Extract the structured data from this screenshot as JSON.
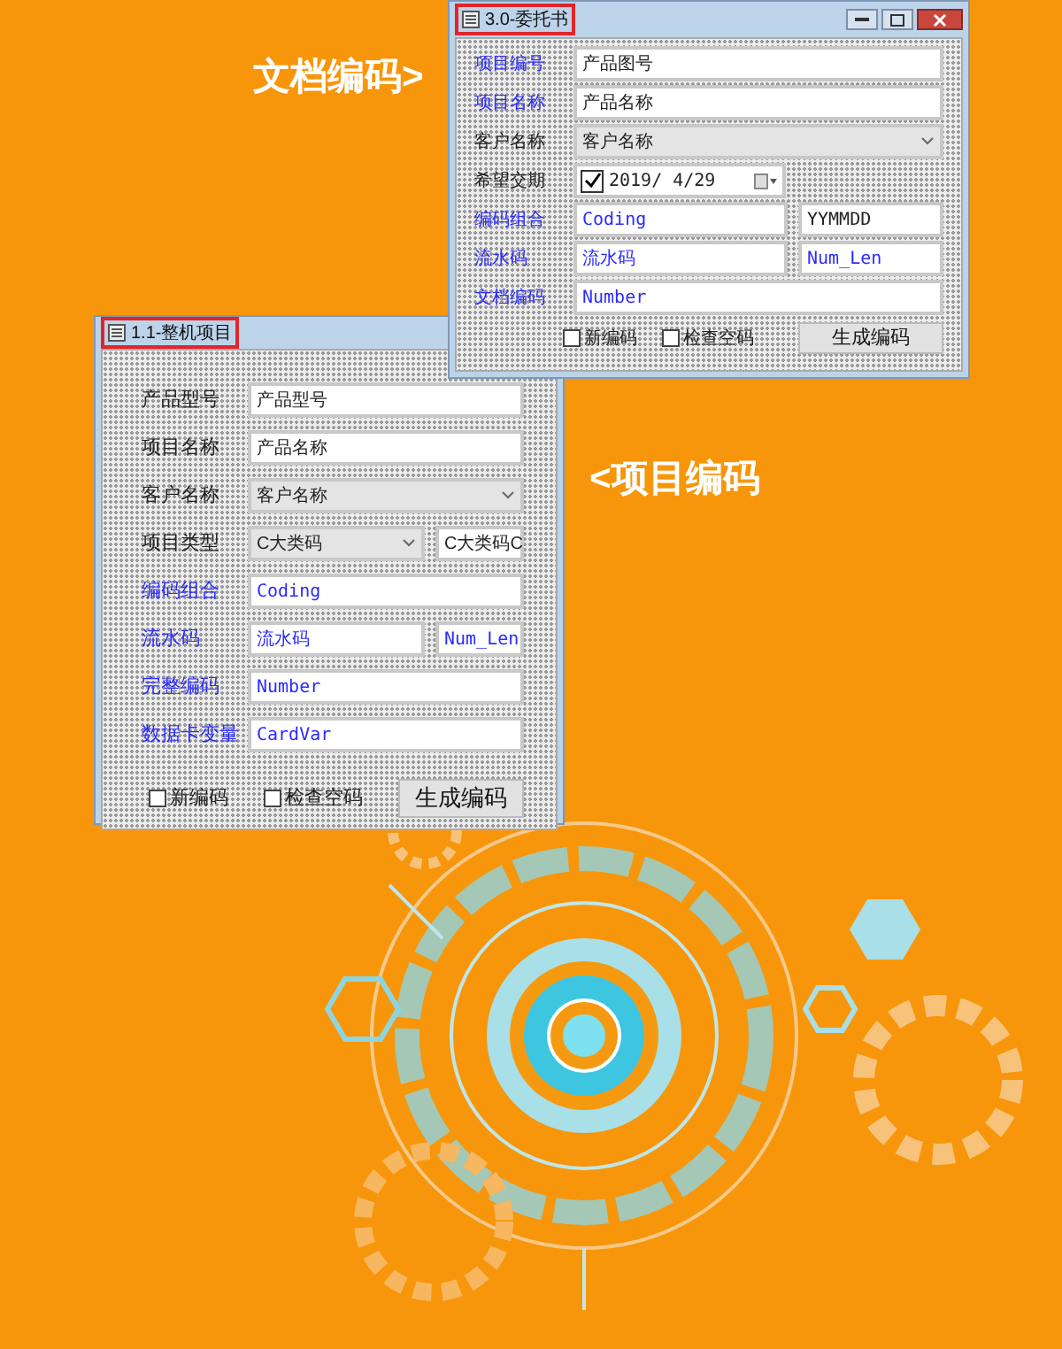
{
  "callouts": [
    {
      "text": "文档编码>"
    },
    {
      "text": "<项目编码"
    }
  ],
  "windows": [
    {
      "title": "3.0-委托书",
      "controls": true,
      "rows": [
        {
          "kind": "text",
          "label": "项目编号",
          "label_blue": true,
          "value": "产品图号",
          "value_blue": false
        },
        {
          "kind": "text",
          "label": "项目名称",
          "label_blue": true,
          "value": "产品名称",
          "value_blue": false
        },
        {
          "kind": "combo",
          "label": "客户名称",
          "label_blue": false,
          "value": "客户名称",
          "value_blue": false
        },
        {
          "kind": "date",
          "label": "希望交期",
          "label_blue": false,
          "value": "2019/ 4/29",
          "checked": true
        },
        {
          "kind": "text_extra",
          "label": "编码组合",
          "label_blue": true,
          "value": "Coding",
          "value_blue": true,
          "extra": "YYMMDD",
          "extra_blue": false
        },
        {
          "kind": "text_extra",
          "label": "流水码",
          "label_blue": true,
          "value": "流水码",
          "value_blue": true,
          "extra": "Num_Len",
          "extra_blue": true
        },
        {
          "kind": "text",
          "label": "文档编码",
          "label_blue": true,
          "value": "Number",
          "value_blue": true
        }
      ],
      "checkboxes": [
        {
          "label": "新编码",
          "checked": false
        },
        {
          "label": "检查空码",
          "checked": false
        }
      ],
      "button": "生成编码"
    },
    {
      "title": "1.1-整机项目",
      "controls": false,
      "rows": [
        {
          "kind": "text",
          "label": "产品型号",
          "label_blue": false,
          "value": "产品型号",
          "value_blue": false
        },
        {
          "kind": "text",
          "label": "项目名称",
          "label_blue": false,
          "value": "产品名称",
          "value_blue": false
        },
        {
          "kind": "combo",
          "label": "客户名称",
          "label_blue": false,
          "value": "客户名称",
          "value_blue": false
        },
        {
          "kind": "combo_extra",
          "label": "项目类型",
          "label_blue": false,
          "value": "C大类码",
          "value_blue": false,
          "extra": "C大类码C",
          "extra_blue": false
        },
        {
          "kind": "text",
          "label": "编码组合",
          "label_blue": true,
          "value": "Coding",
          "value_blue": true
        },
        {
          "kind": "text_extra",
          "label": "流水码",
          "label_blue": true,
          "value": "流水码",
          "value_blue": true,
          "extra": "Num_Len",
          "extra_blue": true
        },
        {
          "kind": "text",
          "label": "完整编码",
          "label_blue": true,
          "value": "Number",
          "value_blue": true
        },
        {
          "kind": "text",
          "label": "数据卡变量",
          "label_blue": true,
          "value": "CardVar",
          "value_blue": true
        }
      ],
      "checkboxes": [
        {
          "label": "新编码",
          "checked": false
        },
        {
          "label": "检查空码",
          "checked": false
        }
      ],
      "button": "生成编码"
    }
  ]
}
